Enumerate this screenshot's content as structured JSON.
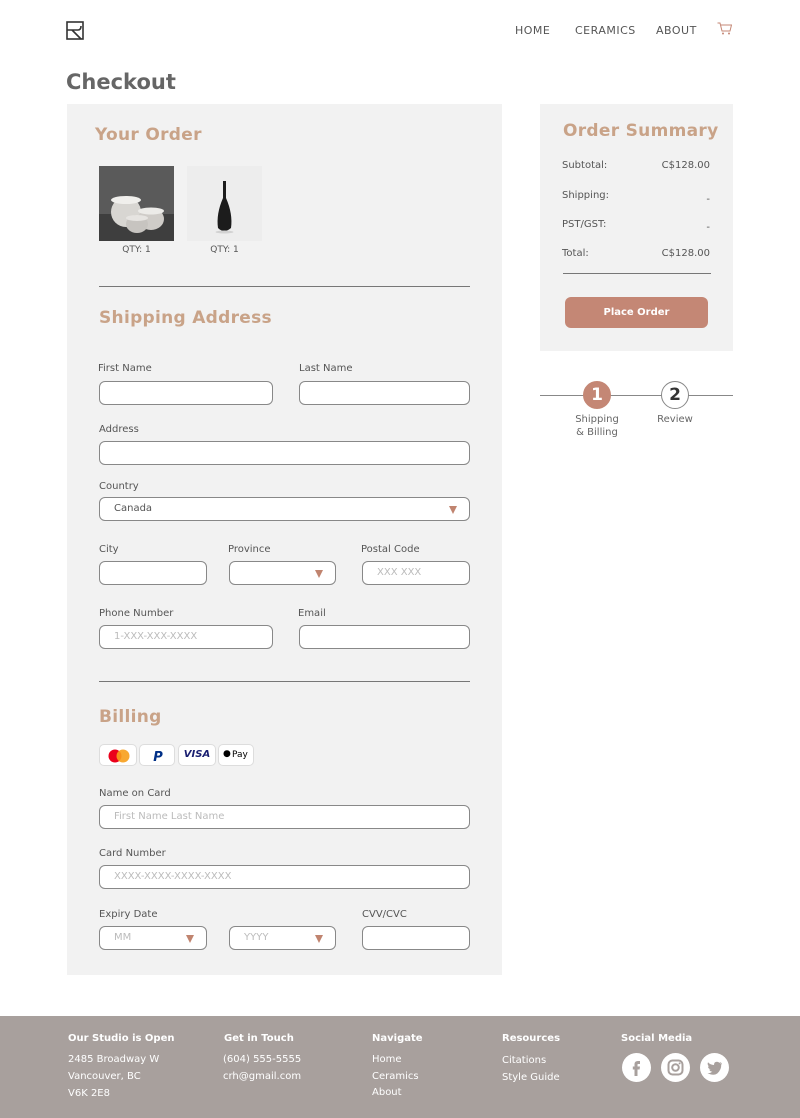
{
  "header": {
    "nav": [
      "HOME",
      "CERAMICS",
      "ABOUT"
    ]
  },
  "page_title": "Checkout",
  "your_order": {
    "title": "Your Order",
    "items": [
      {
        "image": "white ceramic cups",
        "qty": "QTY: 1"
      },
      {
        "image": "black vase",
        "qty": "QTY: 1"
      }
    ]
  },
  "shipping": {
    "title": "Shipping Address",
    "first_name_label": "First Name",
    "last_name_label": "Last Name",
    "address_label": "Address",
    "country_label": "Country",
    "country_value": "Canada",
    "city_label": "City",
    "province_label": "Province",
    "postal_label": "Postal Code",
    "postal_placeholder": "XXX XXX",
    "phone_label": "Phone Number",
    "phone_placeholder": "1-XXX-XXX-XXXX",
    "email_label": "Email"
  },
  "billing": {
    "title": "Billing",
    "payment_methods": [
      "mastercard-icon",
      "paypal-icon",
      "VISA",
      "Pay"
    ],
    "name_label": "Name on Card",
    "name_placeholder": "First Name Last Name",
    "card_label": "Card Number",
    "card_placeholder": "XXXX-XXXX-XXXX-XXXX",
    "expiry_label": "Expiry Date",
    "month_placeholder": "MM",
    "year_placeholder": "YYYY",
    "cvv_label": "CVV/CVC"
  },
  "summary": {
    "title": "Order Summary",
    "subtotal_label": "Subtotal:",
    "subtotal_value": "C$128.00",
    "shipping_label": "Shipping:",
    "shipping_value": "-",
    "tax_label": "PST/GST:",
    "tax_value": "-",
    "total_label": "Total:",
    "total_value": "C$128.00",
    "button": "Place Order"
  },
  "steps": [
    {
      "number": "1",
      "label_line1": "Shipping",
      "label_line2": "& Billing",
      "active": true
    },
    {
      "number": "2",
      "label_line1": "Review",
      "label_line2": "",
      "active": false
    }
  ],
  "footer": {
    "studio_title": "Our Studio is Open",
    "studio_lines": [
      "2485 Broadway W",
      "Vancouver, BC",
      "V6K 2E8"
    ],
    "contact_title": "Get in Touch",
    "contact_lines": [
      "(604) 555-5555",
      "crh@gmail.com"
    ],
    "navigate_title": "Navigate",
    "navigate_links": [
      "Home",
      "Ceramics",
      "About"
    ],
    "resources_title": "Resources",
    "resources_links": [
      "Citations",
      "Style Guide"
    ],
    "social_title": "Social Media",
    "social_icons": [
      "facebook-icon",
      "instagram-icon",
      "twitter-icon"
    ]
  },
  "colors": {
    "accent": "#c48775",
    "heading": "#c9a388",
    "panel": "#f2f2f2",
    "footer": "#a8a09d"
  }
}
